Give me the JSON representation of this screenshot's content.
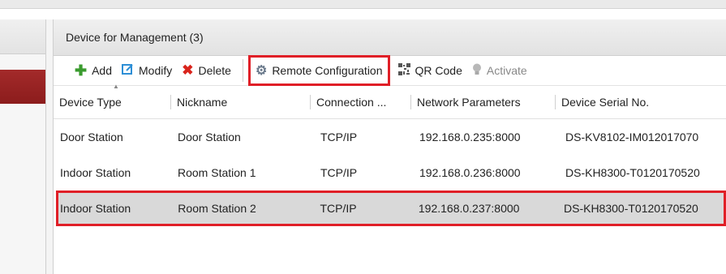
{
  "panel": {
    "title": "Device for Management (3)"
  },
  "toolbar": {
    "add": {
      "label": "Add",
      "icon": "plus-icon"
    },
    "modify": {
      "label": "Modify",
      "icon": "edit-icon"
    },
    "delete": {
      "label": "Delete",
      "icon": "x-icon"
    },
    "remote_config": {
      "label": "Remote Configuration",
      "icon": "gear-icon"
    },
    "qr_code": {
      "label": "QR Code",
      "icon": "qr-code-icon"
    },
    "activate": {
      "label": "Activate",
      "icon": "lightbulb-icon"
    }
  },
  "table": {
    "columns": [
      "Device Type",
      "Nickname",
      "Connection ...",
      "Network Parameters",
      "Device Serial No."
    ],
    "rows": [
      [
        "Door Station",
        "Door Station",
        "TCP/IP",
        "192.168.0.235:8000",
        "DS-KV8102-IM012017070"
      ],
      [
        "Indoor Station",
        "Room Station 1",
        "TCP/IP",
        "192.168.0.236:8000",
        "DS-KH8300-T0120170520"
      ],
      [
        "Indoor Station",
        "Room Station 2",
        "TCP/IP",
        "192.168.0.237:8000",
        "DS-KH8300-T0120170520"
      ]
    ],
    "selected_row": 2
  },
  "colors": {
    "highlight": "#e01f27",
    "selected_bg": "#d9d9d9",
    "left_selected": "#9a2424"
  }
}
